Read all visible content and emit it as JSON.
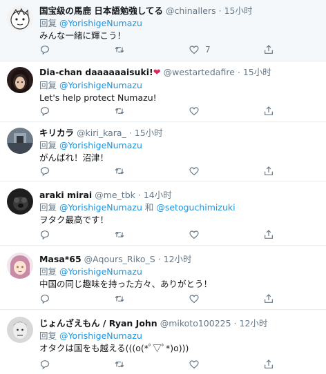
{
  "colors": {
    "link": "#1b95e0",
    "muted": "#657786",
    "text": "#14171a",
    "highlight_bg": "#f5f8fa",
    "heart": "#e0245e"
  },
  "labels": {
    "replying_to": "回复",
    "and": "和",
    "dot": "·"
  },
  "tweets": [
    {
      "name": "国宝级の馬鹿 日本語勉強してる",
      "handle": "@chinallers",
      "time": "15小时",
      "reply_to": "@YorishigeNumazu",
      "text": "みんな一緒に輝こう！",
      "like_count": "7"
    },
    {
      "name": "Dia-chan daaaaaaisuki!",
      "name_emoji": "❤",
      "handle": "@westartedafire",
      "time": "15小时",
      "reply_to": "@YorishigeNumazu",
      "text": "Let's help protect Numazu!"
    },
    {
      "name": "キリカラ",
      "handle": "@kiri_kara_",
      "time": "15小时",
      "reply_to": "@YorishigeNumazu",
      "text": "がんばれ！沼津！"
    },
    {
      "name": "araki mirai",
      "handle": "@me_tbk",
      "time": "14小时",
      "reply_to": "@YorishigeNumazu",
      "reply_to_2": "@setoguchimizuki",
      "text": "ヲタク最高です！"
    },
    {
      "name": "Masa*65",
      "handle": "@Aqours_Riko_S",
      "time": "12小时",
      "reply_to": "@YorishigeNumazu",
      "text": "中国の同じ趣味を持った方々、ありがとう！"
    },
    {
      "name": "じょんざえもん / Ryan John",
      "handle": "@mikoto100225",
      "time": "12小时",
      "reply_to": "@YorishigeNumazu",
      "text": "オタクは国をも越える(((o(*ﾟ▽ﾟ*)o)))"
    }
  ]
}
